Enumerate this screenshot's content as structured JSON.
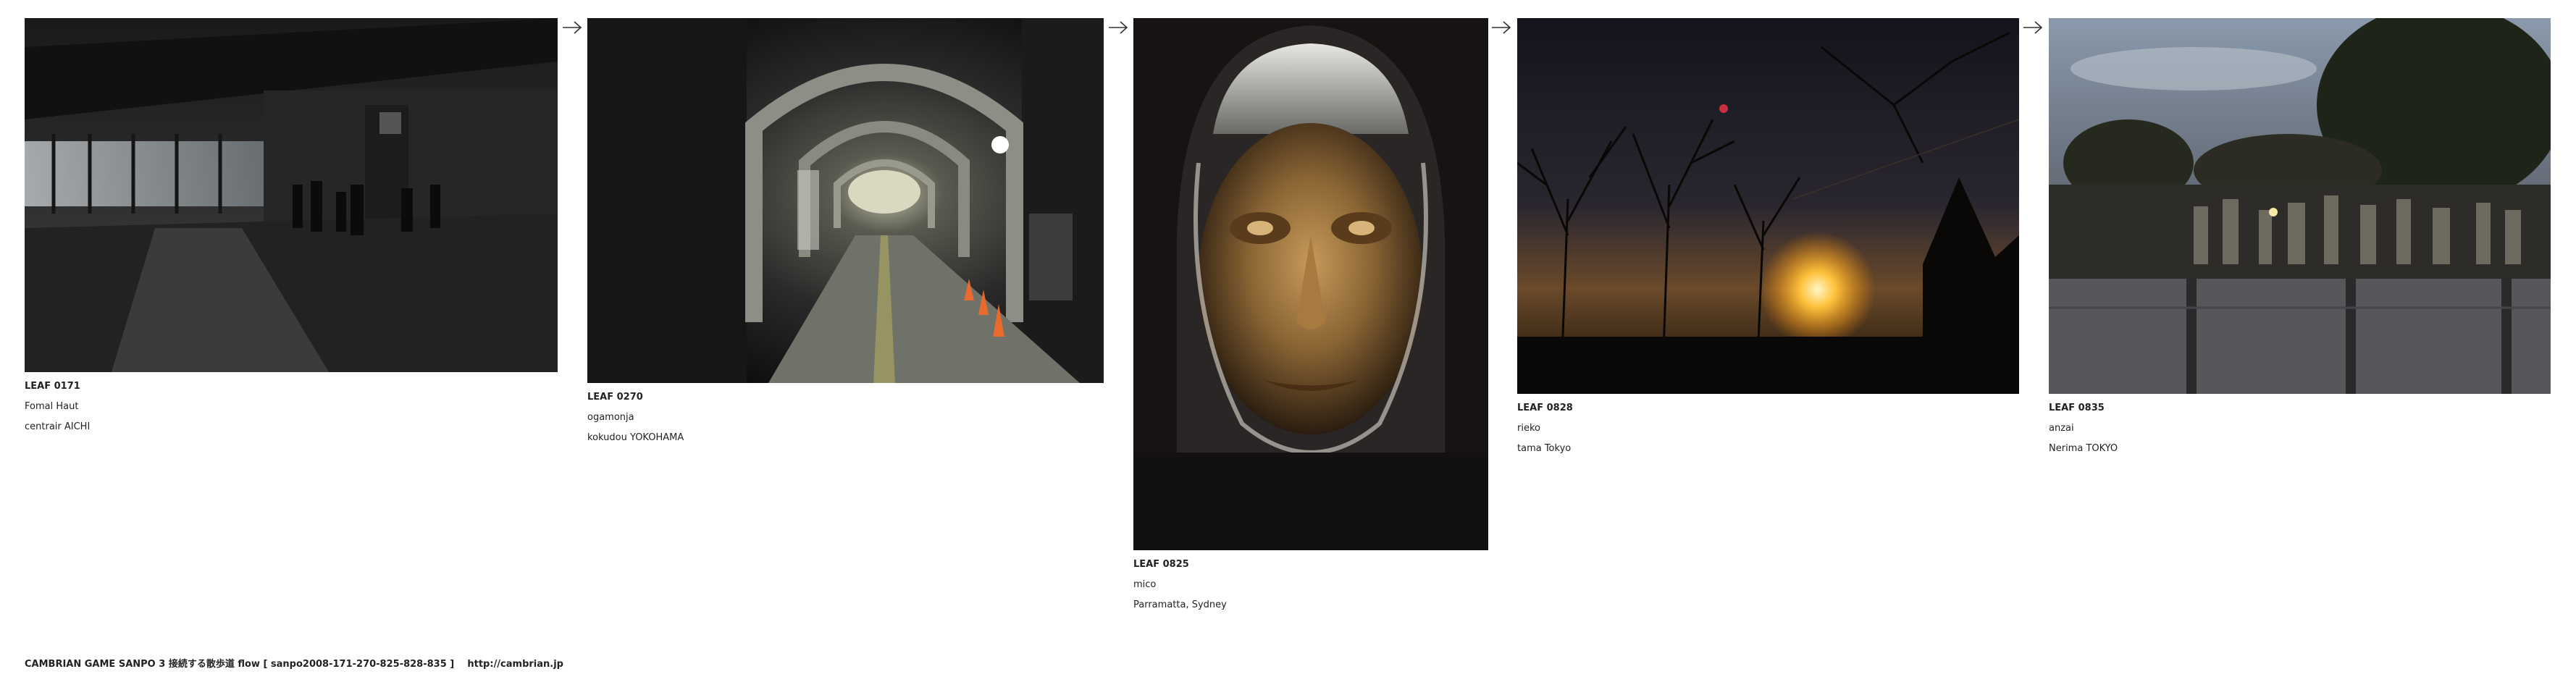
{
  "leaves": [
    {
      "code": "LEAF 0171",
      "author": "Fomal Haut",
      "place": "centrair AICHI",
      "photo_icon": "airport-terminal-photo"
    },
    {
      "code": "LEAF 0270",
      "author": "ogamonja",
      "place": "kokudou YOKOHAMA",
      "photo_icon": "arched-corridor-photo"
    },
    {
      "code": "LEAF 0825",
      "author": "mico",
      "place": "Parramatta, Sydney",
      "photo_icon": "bronze-face-sculpture-photo"
    },
    {
      "code": "LEAF 0828",
      "author": "rieko",
      "place": "tama Tokyo",
      "photo_icon": "sunset-trees-photo"
    },
    {
      "code": "LEAF 0835",
      "author": "anzai",
      "place": "Nerima TOKYO",
      "photo_icon": "cemetery-dusk-photo"
    }
  ],
  "arrow_icon": "right-arrow-icon",
  "footer": {
    "credit": "CAMBRIAN GAME  SANPO 3 接続する散歩道 flow [ sanpo2008-171-270-825-828-835 ]",
    "link": "http://cambrian.jp"
  }
}
